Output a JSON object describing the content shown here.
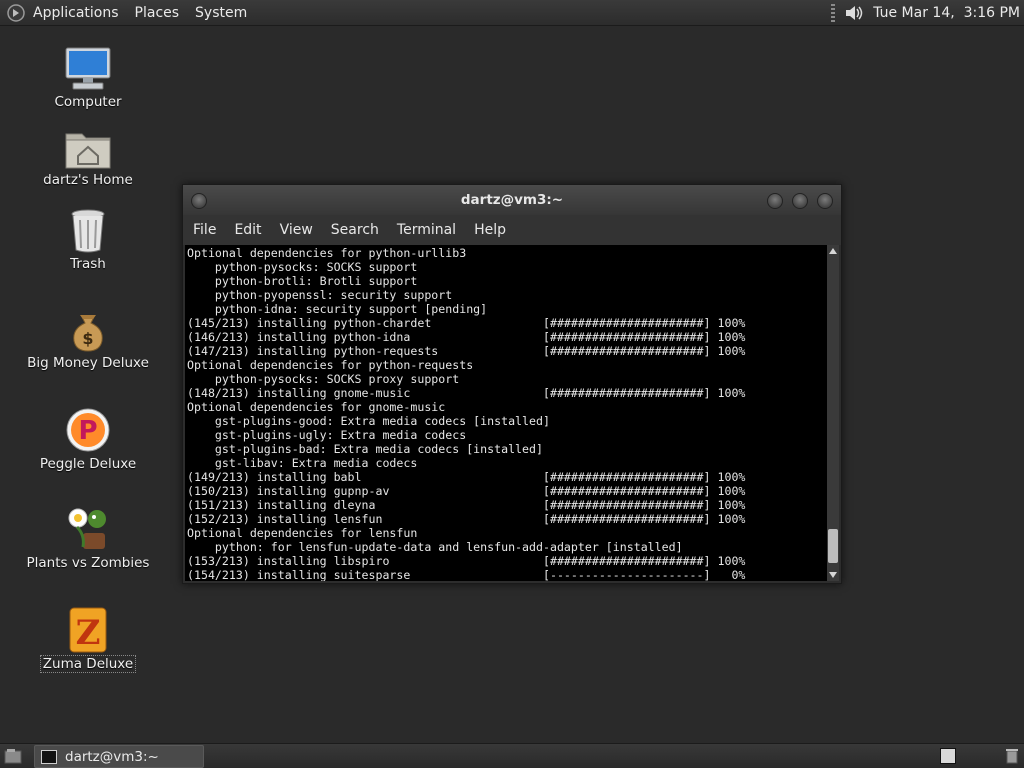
{
  "top_panel": {
    "menus": [
      "Applications",
      "Places",
      "System"
    ],
    "clock": "Tue Mar 14,  3:16 PM",
    "icons": [
      "distro-logo-icon",
      "volume-icon"
    ]
  },
  "desktop_icons": [
    {
      "label": "Computer",
      "icon": "computer-icon"
    },
    {
      "label": "dartz's Home",
      "icon": "home-folder-icon"
    },
    {
      "label": "Trash",
      "icon": "trash-icon"
    },
    {
      "label": "Big Money Deluxe",
      "icon": "money-bag-icon"
    },
    {
      "label": "Peggle Deluxe",
      "icon": "peggle-icon"
    },
    {
      "label": "Plants vs Zombies",
      "icon": "plants-vs-zombies-icon"
    },
    {
      "label": "Zuma Deluxe",
      "icon": "zuma-icon"
    }
  ],
  "terminal": {
    "title": "dartz@vm3:~",
    "menu": [
      "File",
      "Edit",
      "View",
      "Search",
      "Terminal",
      "Help"
    ],
    "output": "Optional dependencies for python-urllib3\n    python-pysocks: SOCKS support\n    python-brotli: Brotli support\n    python-pyopenssl: security support\n    python-idna: security support [pending]\n(145/213) installing python-chardet                [######################] 100%\n(146/213) installing python-idna                   [######################] 100%\n(147/213) installing python-requests               [######################] 100%\nOptional dependencies for python-requests\n    python-pysocks: SOCKS proxy support\n(148/213) installing gnome-music                   [######################] 100%\nOptional dependencies for gnome-music\n    gst-plugins-good: Extra media codecs [installed]\n    gst-plugins-ugly: Extra media codecs\n    gst-plugins-bad: Extra media codecs [installed]\n    gst-libav: Extra media codecs\n(149/213) installing babl                          [######################] 100%\n(150/213) installing gupnp-av                      [######################] 100%\n(151/213) installing dleyna                        [######################] 100%\n(152/213) installing lensfun                       [######################] 100%\nOptional dependencies for lensfun\n    python: for lensfun-update-data and lensfun-add-adapter [installed]\n(153/213) installing libspiro                      [######################] 100%\n(154/213) installing suitesparse                   [----------------------]   0%"
  },
  "taskbar": {
    "task_label": "dartz@vm3:~"
  },
  "colors": {
    "desktop_bg": "#2a2a2a",
    "terminal_bg": "#000000",
    "terminal_fg": "#e6e6e6"
  }
}
